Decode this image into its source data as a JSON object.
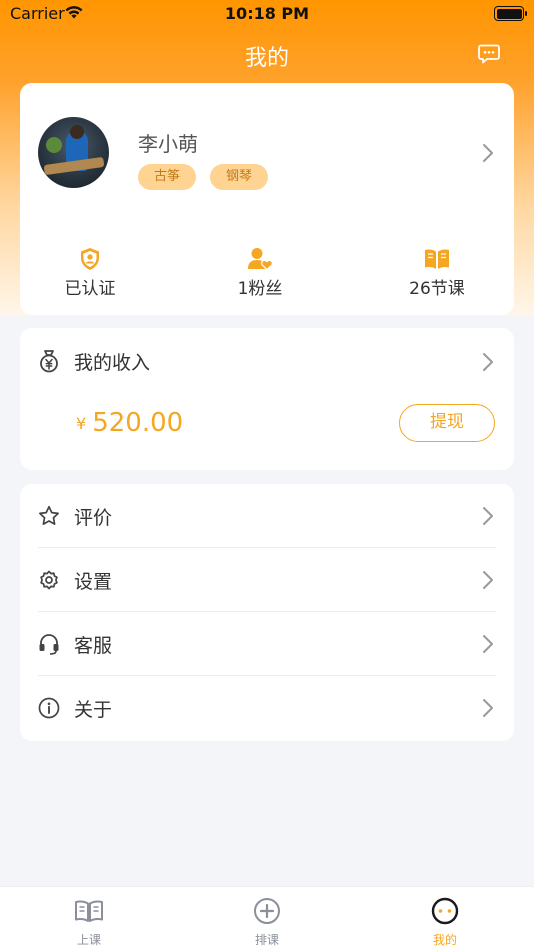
{
  "status_bar": {
    "carrier": "Carrier",
    "time": "10:18 PM"
  },
  "header": {
    "title": "我的",
    "message_icon": "message-icon"
  },
  "profile": {
    "name": "李小萌",
    "tags": [
      "古筝",
      "钢琴"
    ],
    "stats": [
      {
        "icon": "shield-user-icon",
        "label": "已认证"
      },
      {
        "icon": "user-heart-icon",
        "label": "1粉丝"
      },
      {
        "icon": "book-open-icon",
        "label": "26节课"
      }
    ]
  },
  "income": {
    "title": "我的收入",
    "currency": "¥",
    "amount": "520.00",
    "withdraw_label": "提现"
  },
  "menu": {
    "items": [
      {
        "icon": "star-icon",
        "label": "评价"
      },
      {
        "icon": "gear-icon",
        "label": "设置"
      },
      {
        "icon": "headset-icon",
        "label": "客服"
      },
      {
        "icon": "info-icon",
        "label": "关于"
      }
    ]
  },
  "tabbar": {
    "tabs": [
      {
        "icon": "book-icon",
        "label": "上课",
        "active": false
      },
      {
        "icon": "plus-circle-icon",
        "label": "排课",
        "active": false
      },
      {
        "icon": "face-icon",
        "label": "我的",
        "active": true
      }
    ]
  },
  "colors": {
    "accent": "#f5a623",
    "header": "#ff9500",
    "tag_bg": "#ffd492"
  }
}
